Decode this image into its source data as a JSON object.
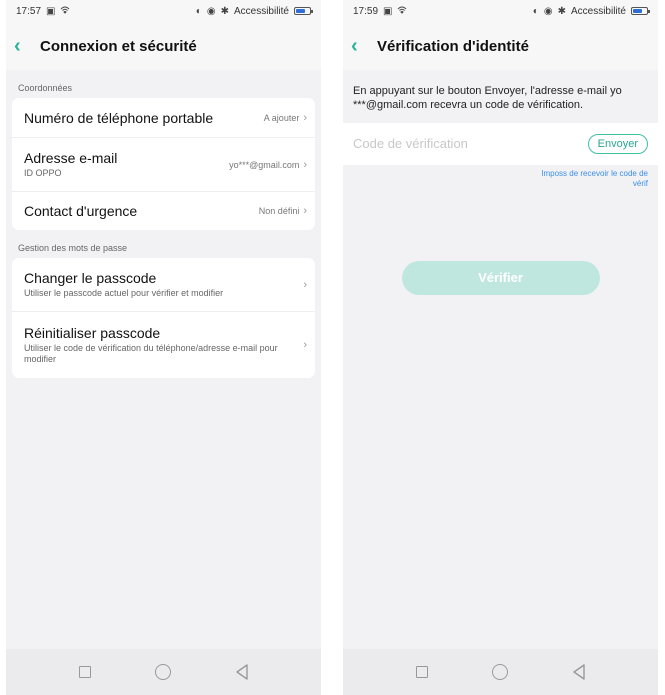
{
  "left": {
    "status": {
      "time": "17:57",
      "accessibility": "Accessibilité",
      "battery_level": 0.7
    },
    "title": "Connexion et sécurité",
    "sections": [
      {
        "label": "Coordonnées",
        "items": [
          {
            "title": "Numéro de téléphone portable",
            "value": "A ajouter"
          },
          {
            "title": "Adresse e-mail",
            "subtitle": "ID OPPO",
            "value": "yo***@gmail.com"
          },
          {
            "title": "Contact d'urgence",
            "value": "Non défini"
          }
        ]
      },
      {
        "label": "Gestion des mots de passe",
        "items": [
          {
            "title": "Changer le passcode",
            "subtitle": "Utiliser le passcode actuel pour vérifier et modifier"
          },
          {
            "title": "Réinitialiser passcode",
            "subtitle": "Utiliser le code de vérification du téléphone/adresse e-mail pour modifier"
          }
        ]
      }
    ]
  },
  "right": {
    "status": {
      "time": "17:59",
      "accessibility": "Accessibilité",
      "battery_level": 0.7
    },
    "title": "Vérification d'identité",
    "info": "En appuyant sur le bouton Envoyer, l'adresse e-mail yo ***@gmail.com recevra un code de vérification.",
    "code_placeholder": "Code de vérification",
    "send_label": "Envoyer",
    "help_link": "Imposs de recevoir le code de vérif",
    "verify_label": "Vérifier"
  },
  "icons": {
    "back": "chevron-left-icon",
    "chevron": "chevron-right-icon",
    "nav": [
      "square-icon",
      "circle-icon",
      "triangle-back-icon"
    ]
  },
  "colors": {
    "accent": "#26b49d",
    "link": "#3b8ee8",
    "verify_disabled": "#bfe7e0"
  }
}
